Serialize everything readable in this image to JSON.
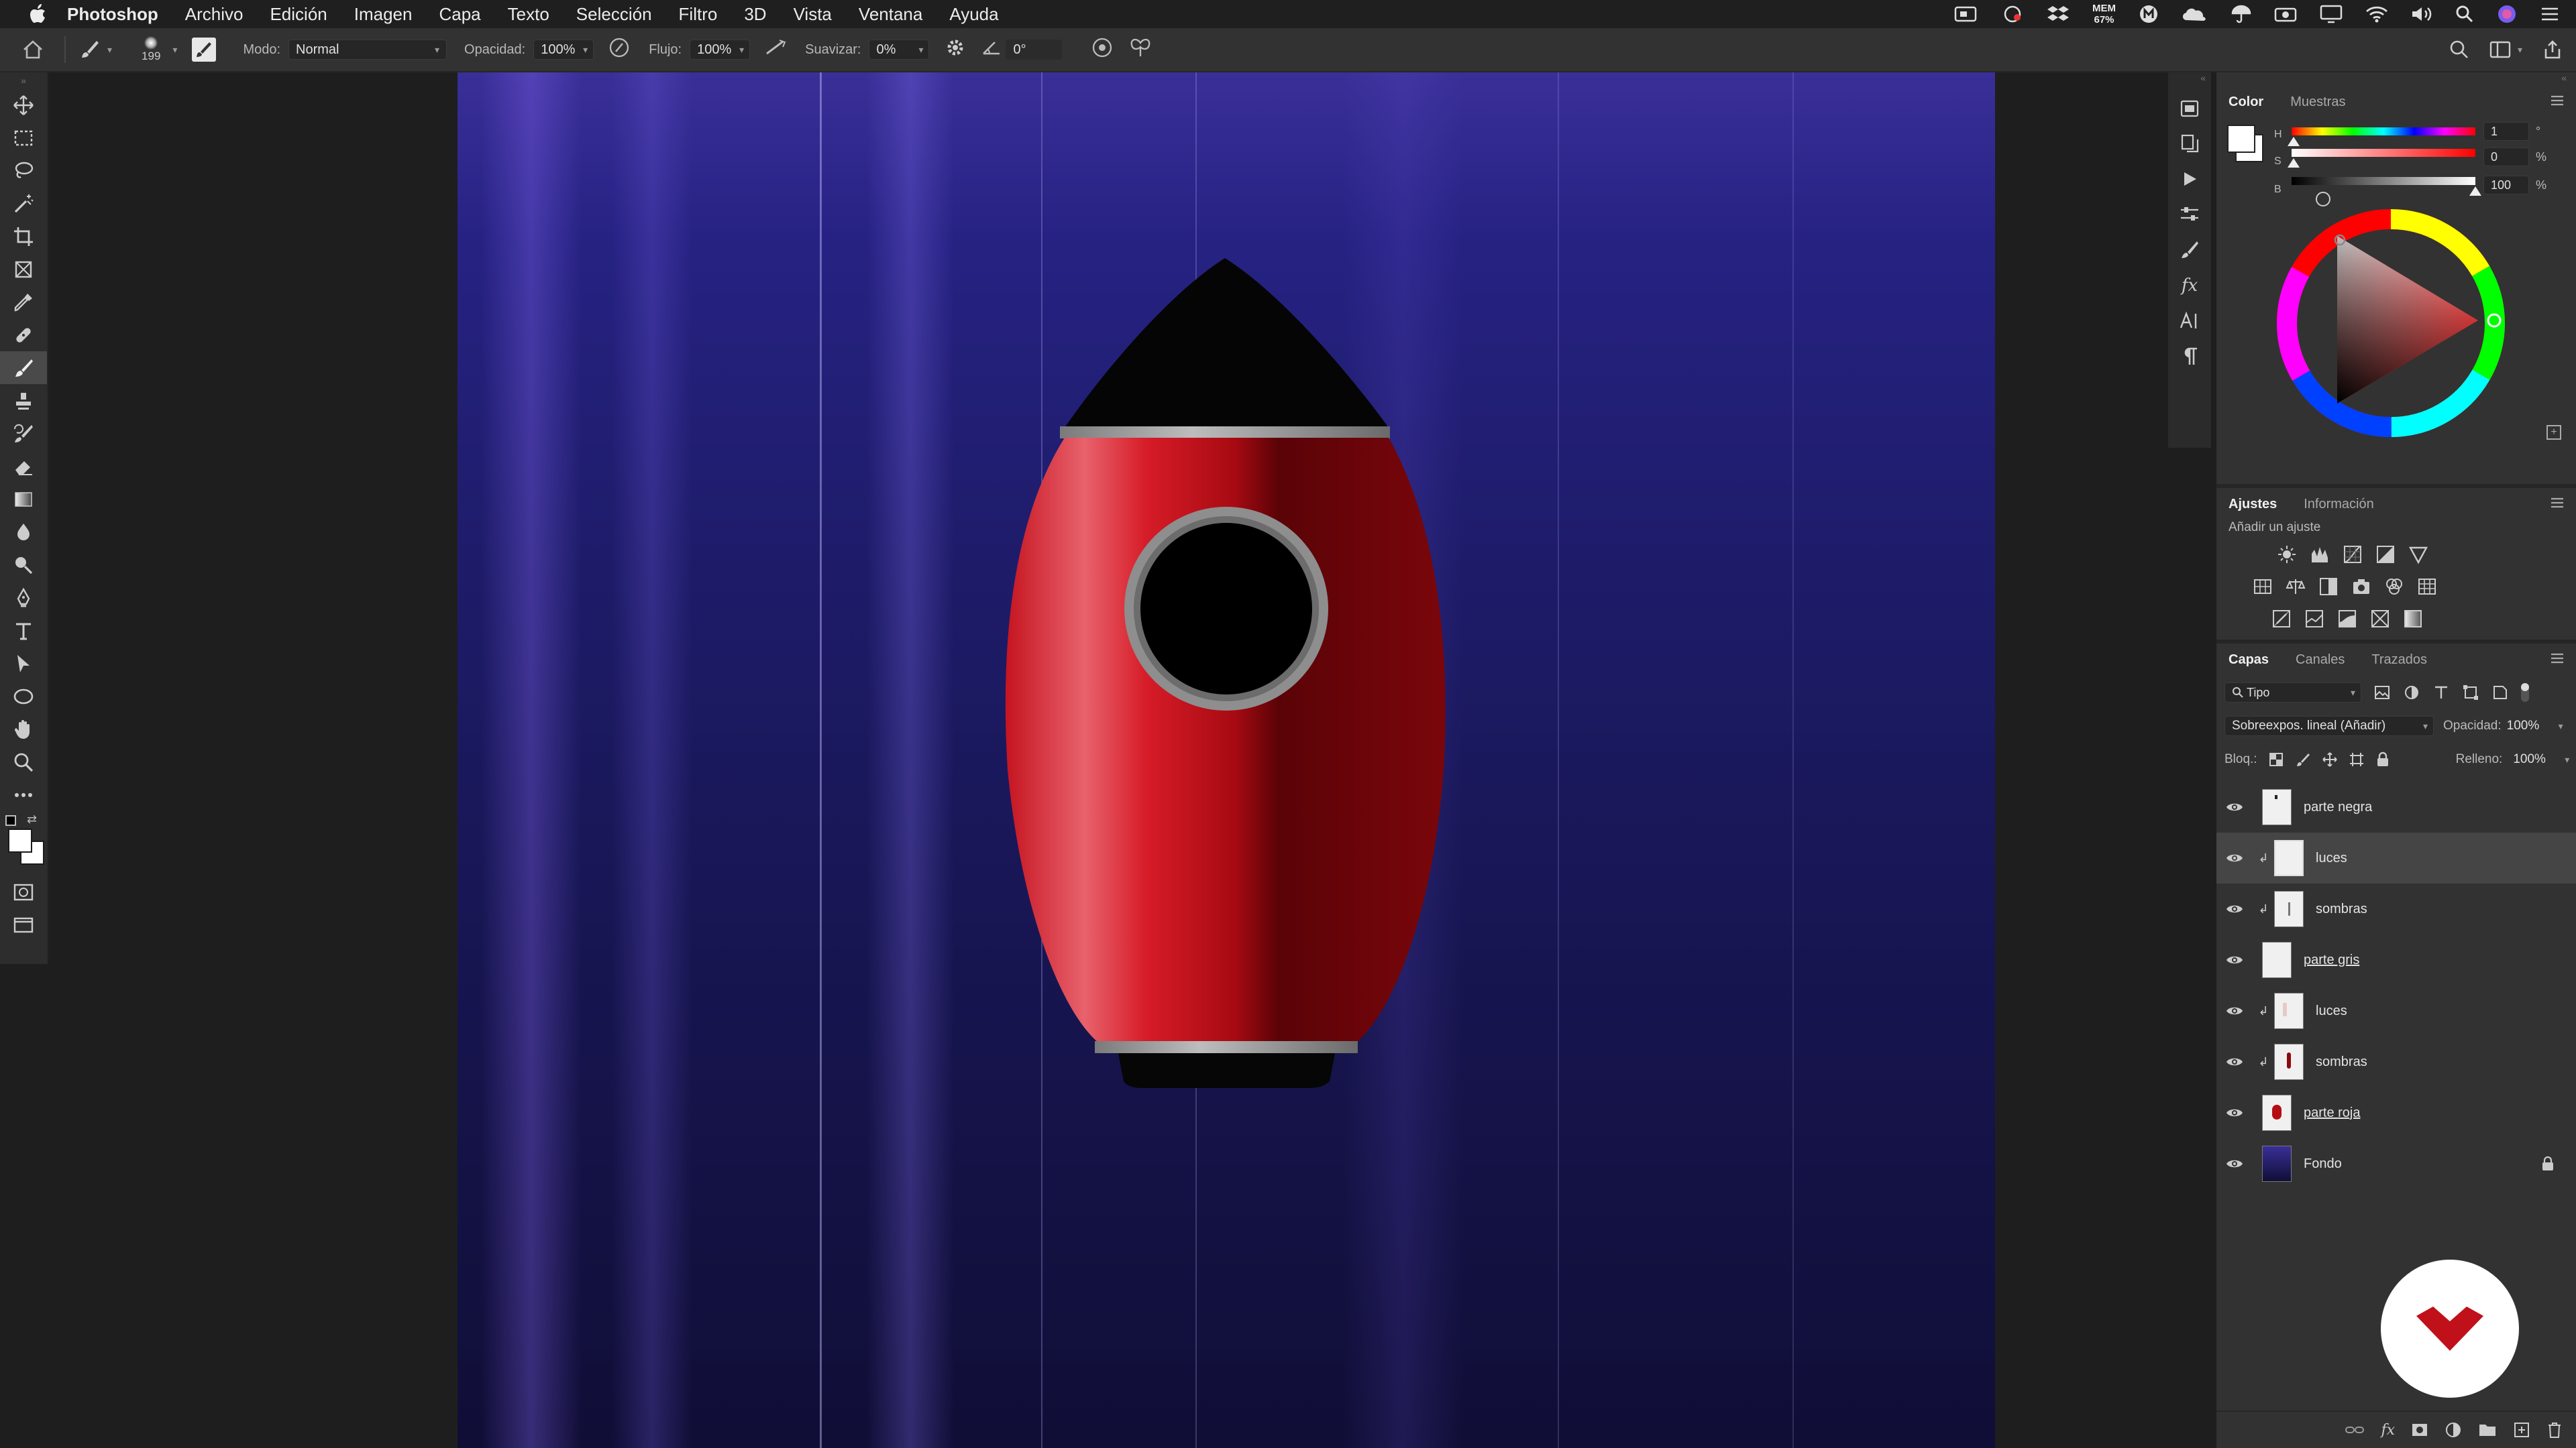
{
  "menubar": {
    "app_name": "Photoshop",
    "items": [
      "Archivo",
      "Edición",
      "Imagen",
      "Capa",
      "Texto",
      "Selección",
      "Filtro",
      "3D",
      "Vista",
      "Ventana",
      "Ayuda"
    ],
    "mem_label": "MEM",
    "mem_value": "67%"
  },
  "options": {
    "brush_size": "199",
    "mode_label": "Modo:",
    "mode_value": "Normal",
    "opacity_label": "Opacidad:",
    "opacity_value": "100%",
    "flow_label": "Flujo:",
    "flow_value": "100%",
    "smooth_label": "Suavizar:",
    "smooth_value": "0%",
    "angle_value": "0°"
  },
  "color_panel": {
    "tabs": [
      "Color",
      "Muestras"
    ],
    "h_label": "H",
    "h_value": "1",
    "h_unit": "°",
    "s_label": "S",
    "s_value": "0",
    "s_unit": "%",
    "b_label": "B",
    "b_value": "100",
    "b_unit": "%"
  },
  "adjustments_panel": {
    "tabs": [
      "Ajustes",
      "Información"
    ],
    "subtitle": "Añadir un ajuste"
  },
  "layers_panel": {
    "tabs": [
      "Capas",
      "Canales",
      "Trazados"
    ],
    "filter_label": "Tipo",
    "blend_mode": "Sobreexpos. lineal (Añadir)",
    "opacity_label": "Opacidad:",
    "opacity_value": "100%",
    "lock_label": "Bloq.:",
    "fill_label": "Relleno:",
    "fill_value": "100%",
    "layers": [
      {
        "name": "parte negra",
        "clipped": false,
        "underlined": false,
        "selected": false
      },
      {
        "name": "luces",
        "clipped": true,
        "underlined": false,
        "selected": true
      },
      {
        "name": "sombras",
        "clipped": true,
        "underlined": false,
        "selected": false
      },
      {
        "name": "parte gris",
        "clipped": false,
        "underlined": true,
        "selected": false
      },
      {
        "name": "luces",
        "clipped": true,
        "underlined": false,
        "selected": false
      },
      {
        "name": "sombras",
        "clipped": true,
        "underlined": false,
        "selected": false
      },
      {
        "name": "parte roja",
        "clipped": false,
        "underlined": true,
        "selected": false
      },
      {
        "name": "Fondo",
        "clipped": false,
        "underlined": false,
        "selected": false,
        "locked": true
      }
    ]
  },
  "colors": {
    "rocket_red": "#b50d14",
    "background_blue": "#1e1c6a",
    "panel": "#323232",
    "logo_red": "#c0101a"
  }
}
